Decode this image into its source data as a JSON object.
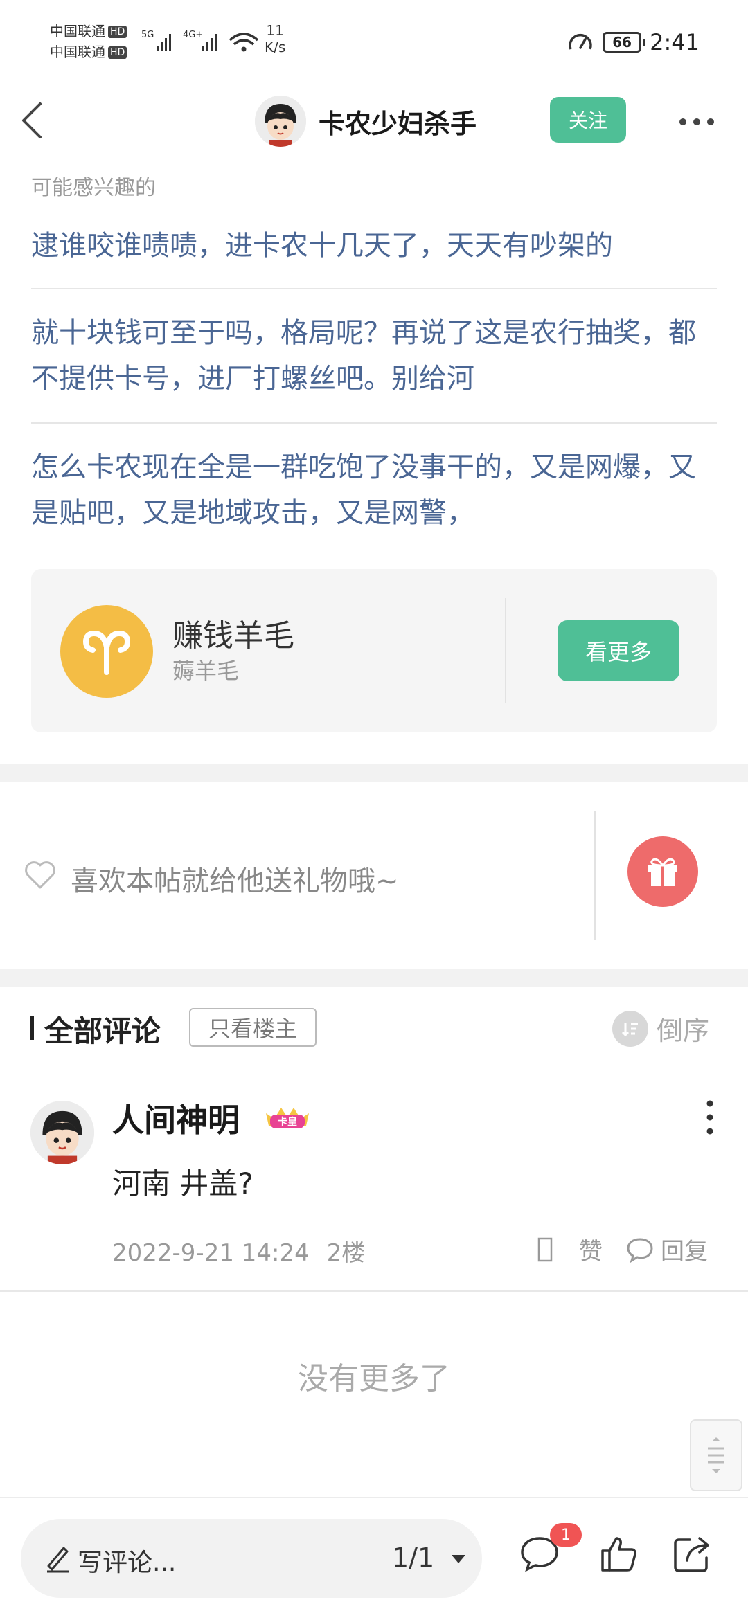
{
  "status_bar": {
    "carrier_1": "中国联通",
    "carrier_2": "中国联通",
    "hd_1": "HD",
    "hd_2": "HD",
    "net_type_1": "5G",
    "net_type_2": "4G+",
    "speed_value": "11",
    "speed_unit": "K/s",
    "battery": "66",
    "time": "2:41"
  },
  "header": {
    "author_name": "卡农少妇杀手",
    "follow_label": "关注",
    "icons": {
      "back": "chevron-left-icon",
      "more": "more-horizontal-icon"
    }
  },
  "recommended": {
    "title": "可能感兴趣的",
    "items": [
      {
        "text": "逮谁咬谁啧啧，进卡农十几天了，天天有吵架的"
      },
      {
        "text": "就十块钱可至于吗，格局呢？再说了这是农行抽奖，都不提供卡号，进厂打螺丝吧。别给河"
      },
      {
        "text": "怎么卡农现在全是一群吃饱了没事干的，又是网爆，又是贴吧，又是地域攻击，又是网警，"
      }
    ]
  },
  "group_card": {
    "name": "赚钱羊毛",
    "subtitle": "薅羊毛",
    "button_label": "看更多",
    "icon_color": "#f4bd45"
  },
  "gift": {
    "prompt": "喜欢本帖就给他送礼物哦~",
    "button_color": "#ee6b6b"
  },
  "comments": {
    "title": "全部评论",
    "op_only_label": "只看楼主",
    "sort_label": "倒序",
    "items": [
      {
        "author": "人间神明",
        "badge": "卡皇",
        "body": "河南 井盖?",
        "timestamp": "2022-9-21 14:24",
        "floor": "2楼",
        "like_label": "赞",
        "reply_label": "回复"
      }
    ],
    "no_more": "没有更多了"
  },
  "bottom_bar": {
    "write_placeholder": "写评论...",
    "page_indicator": "1/1",
    "comment_badge": "1"
  },
  "colors": {
    "accent_green": "#4fbf96",
    "link_blue": "#4a6694",
    "badge_red": "#f05454"
  }
}
